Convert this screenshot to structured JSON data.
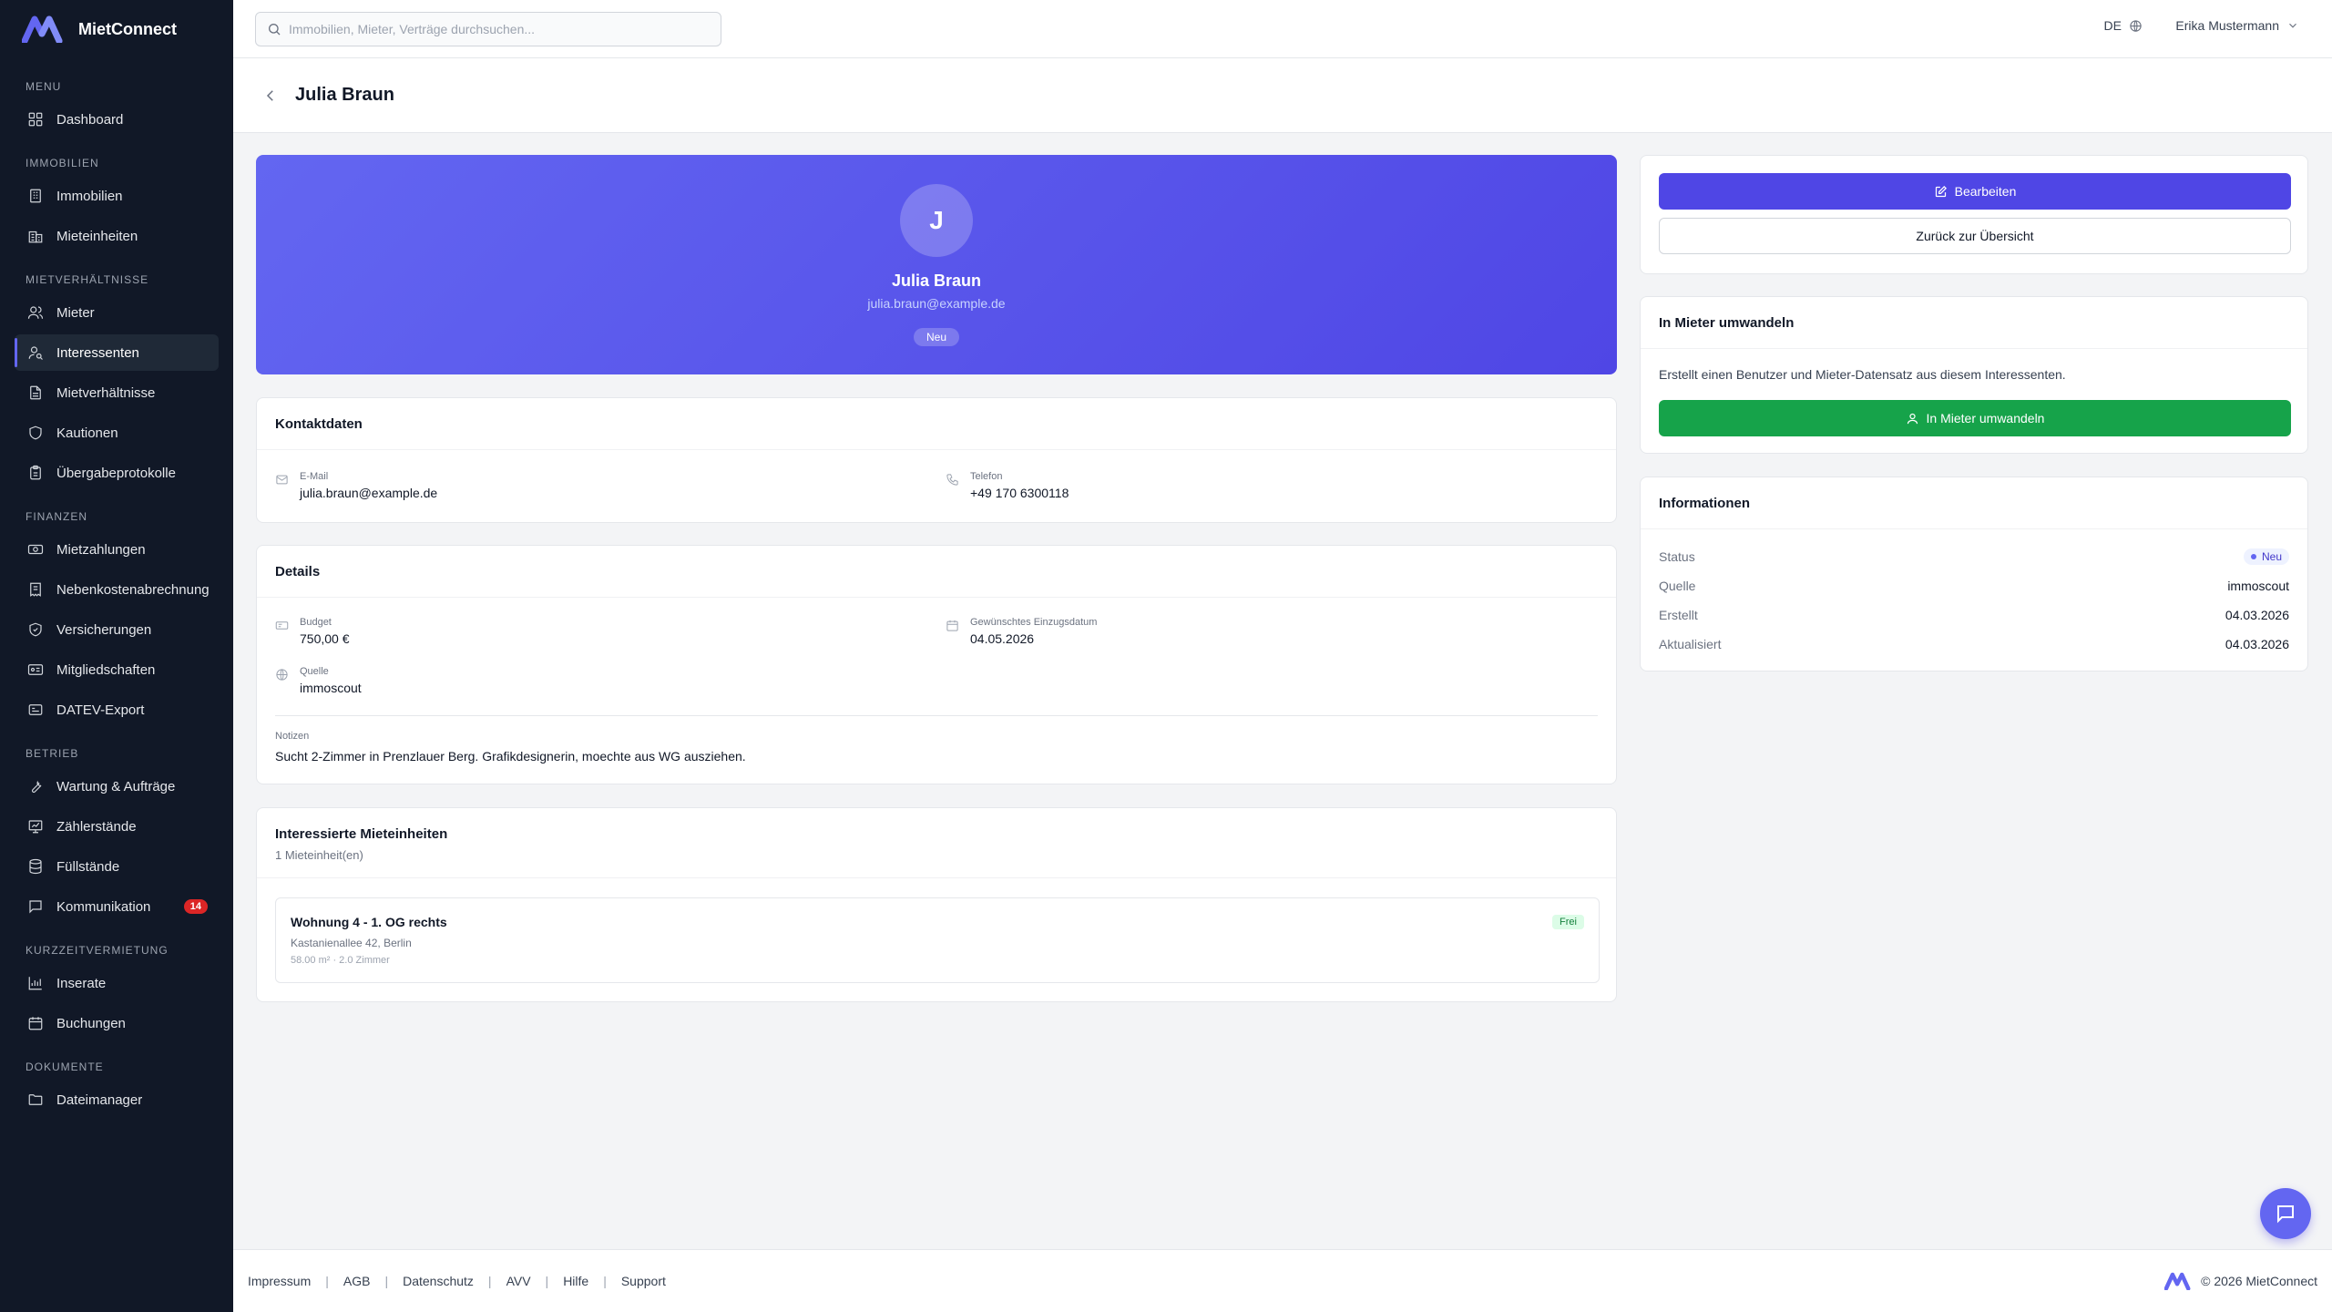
{
  "app": {
    "name": "MietConnect"
  },
  "colors": {
    "sidebar": "#111827",
    "accent": "#4f46e5",
    "success": "#16a34a",
    "danger": "#dc2626"
  },
  "sidebar": {
    "sections": [
      "Menu",
      "Immobilien",
      "Mietverhältnisse",
      "Finanzen",
      "Betrieb",
      "Kurzzeitvermietung",
      "Dokumente"
    ],
    "items": [
      {
        "label": "Dashboard",
        "icon": "grid-icon"
      },
      {
        "label": "Immobilien",
        "icon": "building-icon"
      },
      {
        "label": "Mieteinheiten",
        "icon": "building-units-icon"
      },
      {
        "label": "Mieter",
        "icon": "users-icon"
      },
      {
        "label": "Interessenten",
        "icon": "user-search-icon",
        "active": true
      },
      {
        "label": "Mietverhältnisse",
        "icon": "file-text-icon"
      },
      {
        "label": "Kautionen",
        "icon": "shield-icon"
      },
      {
        "label": "Übergabeprotokolle",
        "icon": "clipboard-icon"
      },
      {
        "label": "Mietzahlungen",
        "icon": "banknote-icon"
      },
      {
        "label": "Nebenkostenabrechnung",
        "icon": "receipt-icon"
      },
      {
        "label": "Versicherungen",
        "icon": "shield-check-icon"
      },
      {
        "label": "Mitgliedschaften",
        "icon": "id-card-icon"
      },
      {
        "label": "DATEV-Export",
        "icon": "export-icon"
      },
      {
        "label": "Wartung & Aufträge",
        "icon": "wrench-icon"
      },
      {
        "label": "Zählerstände",
        "icon": "gauge-icon"
      },
      {
        "label": "Füllstände",
        "icon": "database-icon"
      },
      {
        "label": "Kommunikation",
        "icon": "message-icon",
        "badge": "14"
      },
      {
        "label": "Inserate",
        "icon": "chart-icon"
      },
      {
        "label": "Buchungen",
        "icon": "calendar-icon"
      },
      {
        "label": "Dateimanager",
        "icon": "folder-icon"
      }
    ]
  },
  "topbar": {
    "search_placeholder": "Immobilien, Mieter, Verträge durchsuchen...",
    "language": "DE",
    "user_name": "Erika Mustermann"
  },
  "page": {
    "title": "Julia Braun"
  },
  "profile": {
    "initial": "J",
    "name": "Julia Braun",
    "email": "julia.braun@example.de",
    "status": "Neu"
  },
  "contact": {
    "title": "Kontaktdaten",
    "email_label": "E-Mail",
    "email": "julia.braun@example.de",
    "phone_label": "Telefon",
    "phone": "+49 170 6300118"
  },
  "details": {
    "title": "Details",
    "budget_label": "Budget",
    "budget": "750,00 €",
    "movein_label": "Gewünschtes Einzugsdatum",
    "movein": "04.05.2026",
    "source_label": "Quelle",
    "source": "immoscout",
    "notes_label": "Notizen",
    "notes": "Sucht 2-Zimmer in Prenzlauer Berg. Grafikdesignerin, moechte aus WG ausziehen."
  },
  "interested_units": {
    "title": "Interessierte Mieteinheiten",
    "count": "1 Mieteinheit(en)",
    "units": [
      {
        "title": "Wohnung 4 - 1. OG rechts",
        "address": "Kastanienallee 42, Berlin",
        "meta": "58.00 m² · 2.0 Zimmer",
        "status": "Frei"
      }
    ]
  },
  "actions": {
    "edit": "Bearbeiten",
    "back": "Zurück zur Übersicht"
  },
  "convert": {
    "title": "In Mieter umwandeln",
    "description": "Erstellt einen Benutzer und Mieter-Datensatz aus diesem Interessenten.",
    "button": "In Mieter umwandeln"
  },
  "info": {
    "title": "Informationen",
    "rows": [
      {
        "key": "Status",
        "value": "Neu"
      },
      {
        "key": "Quelle",
        "value": "immoscout"
      },
      {
        "key": "Erstellt",
        "value": "04.03.2026"
      },
      {
        "key": "Aktualisiert",
        "value": "04.03.2026"
      }
    ]
  },
  "footer": {
    "links": [
      "Impressum",
      "AGB",
      "Datenschutz",
      "AVV",
      "Hilfe",
      "Support"
    ],
    "copyright": "© 2026 MietConnect"
  }
}
